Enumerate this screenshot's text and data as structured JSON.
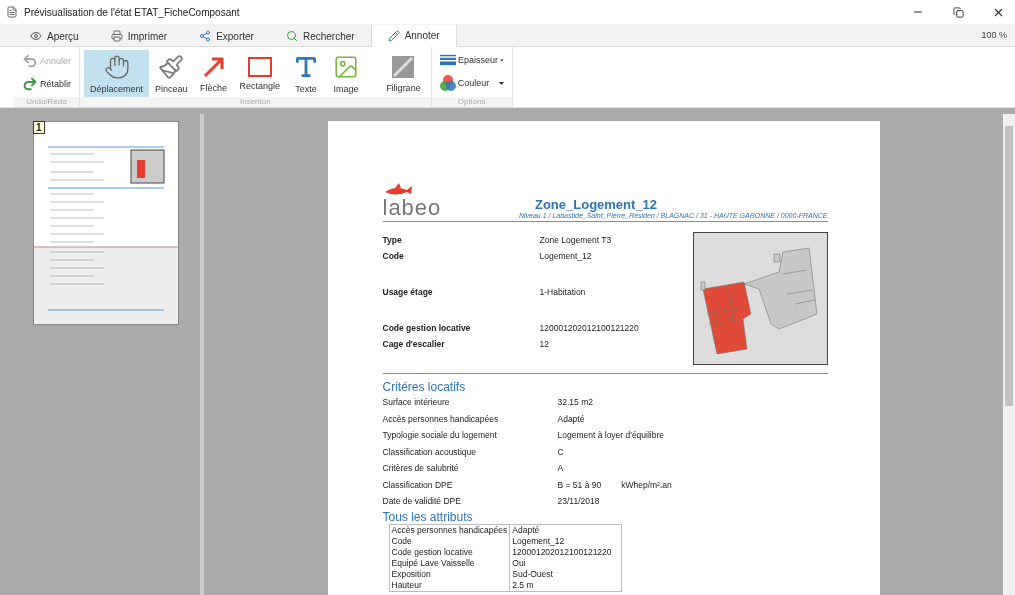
{
  "window": {
    "title": "Prévisualisation de l'état ETAT_FicheComposant"
  },
  "tabs": [
    {
      "label": "Aperçu",
      "kind": "eye",
      "selected": false
    },
    {
      "label": "Imprimer",
      "kind": "printer",
      "selected": false
    },
    {
      "label": "Exporter",
      "kind": "share",
      "selected": false
    },
    {
      "label": "Rechercher",
      "kind": "search",
      "selected": false
    },
    {
      "label": "Annoter",
      "kind": "pencil",
      "selected": true
    }
  ],
  "zoom": "100 %",
  "ribbon": {
    "undo_group": {
      "label": "Undo/Redo",
      "items": [
        {
          "label": "Annuler",
          "kind": "undo",
          "disabled": true
        },
        {
          "label": "Rétablir",
          "kind": "redo",
          "disabled": false
        }
      ]
    },
    "insertion_group": {
      "label": "Insertion",
      "items": [
        {
          "label": "Déplacement",
          "kind": "hand",
          "selected": true
        },
        {
          "label": "Pinceau",
          "kind": "brush",
          "selected": false
        },
        {
          "label": "Flèche",
          "kind": "arrow",
          "selected": false
        },
        {
          "label": "Rectangle",
          "kind": "rectangle",
          "selected": false
        },
        {
          "label": "Texte",
          "kind": "text",
          "selected": false
        },
        {
          "label": "Image",
          "kind": "image",
          "selected": false
        },
        {
          "label": "Filigrane",
          "kind": "watermark",
          "selected": false
        }
      ]
    },
    "options_group": {
      "label": "Options",
      "items": [
        {
          "label": "Epaisseur",
          "kind": "lines"
        },
        {
          "label": "Couleur",
          "kind": "color"
        }
      ]
    }
  },
  "thumbnails": [
    {
      "page": "1",
      "selected": true
    }
  ],
  "document": {
    "logo": "labeo",
    "title": "Zone_Logement_12",
    "address": "Niveau 1 / Labastide_Saint_Pierre_Résiden / BLAGNAC / 31 - HAUTE GARONNE / 0000-FRANCE",
    "field_groups": [
      [
        {
          "label": "Type",
          "value": "Zone Logement T3"
        },
        {
          "label": "Code",
          "value": "Logement_12"
        }
      ],
      [
        {
          "label": "Usage étage",
          "value": "1-Habitation"
        }
      ],
      [
        {
          "label": "Code gestion locative",
          "value": "120001202012100121220"
        },
        {
          "label": "Cage d'escalier",
          "value": "12"
        }
      ]
    ],
    "criteria_title": "Critéres locatifs",
    "criteria": [
      {
        "label": "Surface intérieure",
        "value": "32.15 m2"
      },
      {
        "label": "Accès personnes handicapées",
        "value": "Adapté"
      },
      {
        "label": "Typologie sociale du logement",
        "value": "Logement à loyer d'équilibre"
      },
      {
        "label": "Classification acoustique",
        "value": "C"
      },
      {
        "label": "Critères de salubrité",
        "value": "A"
      },
      {
        "label": "Classification DPE",
        "value": "B = 51 à 90",
        "unit": "kWhep/m².an"
      },
      {
        "label": "Date de validité DPE",
        "value": "23/11/2018"
      }
    ],
    "attributes_title": "Tous les attributs",
    "attributes": [
      {
        "name": "Accès personnes handicapées",
        "value": "Adapté"
      },
      {
        "name": "Code",
        "value": "Logement_12"
      },
      {
        "name": "Code gestion locative",
        "value": "120001202012100121220"
      },
      {
        "name": "Equipé Lave Vaisselle",
        "value": "Oui"
      },
      {
        "name": "Exposition",
        "value": "Sud-Ouest"
      },
      {
        "name": "Hauteur",
        "value": "2.5 m"
      }
    ]
  }
}
